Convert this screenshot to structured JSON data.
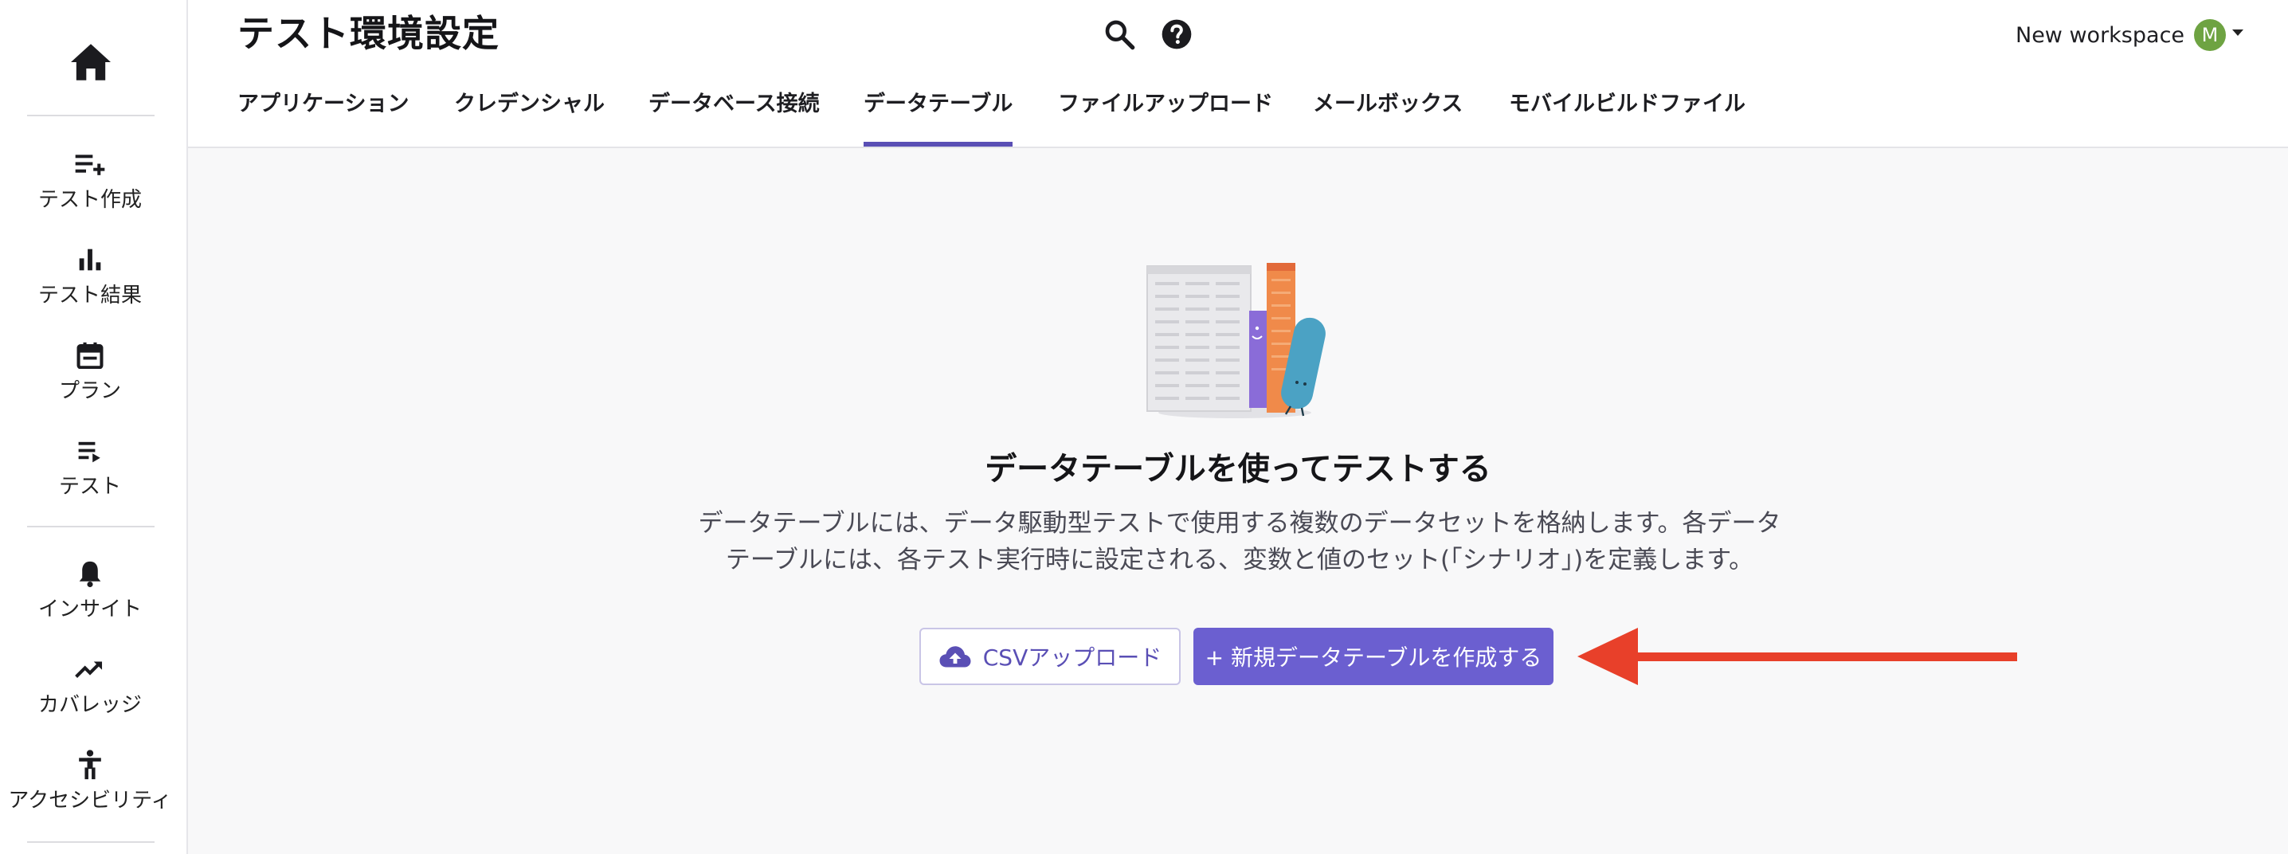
{
  "sidebar": {
    "home_icon": "home-icon",
    "items": [
      {
        "label": "テスト作成",
        "icon": "playlist-add-icon"
      },
      {
        "label": "テスト結果",
        "icon": "bar-chart-icon"
      },
      {
        "label": "プラン",
        "icon": "calendar-icon"
      },
      {
        "label": "テスト",
        "icon": "playlist-play-icon"
      },
      {
        "label": "インサイト",
        "icon": "bell-icon"
      },
      {
        "label": "カバレッジ",
        "icon": "trending-up-icon"
      },
      {
        "label": "アクセシビリティ",
        "icon": "accessibility-icon"
      }
    ]
  },
  "header": {
    "title": "テスト環境設定",
    "tabs": [
      {
        "label": "アプリケーション"
      },
      {
        "label": "クレデンシャル"
      },
      {
        "label": "データベース接続"
      },
      {
        "label": "データテーブル",
        "active": true
      },
      {
        "label": "ファイルアップロード"
      },
      {
        "label": "メールボックス"
      },
      {
        "label": "モバイルビルドファイル"
      }
    ],
    "workspace_name": "New workspace",
    "avatar_initial": "M",
    "avatar_color": "#6ea342"
  },
  "main": {
    "empty_title": "データテーブルを使ってテストする",
    "empty_desc_line1": "データテーブルには、データ駆動型テストで使用する複数のデータセットを格納します。各データ",
    "empty_desc_line2": "テーブルには、各テスト実行時に設定される、変数と値のセット(「シナリオ」)を定義します。",
    "csv_upload_label": "CSVアップロード",
    "new_table_label": "+ 新規データテーブルを作成する",
    "accent_color": "#6b5fd0",
    "arrow_color": "#e8402a"
  }
}
